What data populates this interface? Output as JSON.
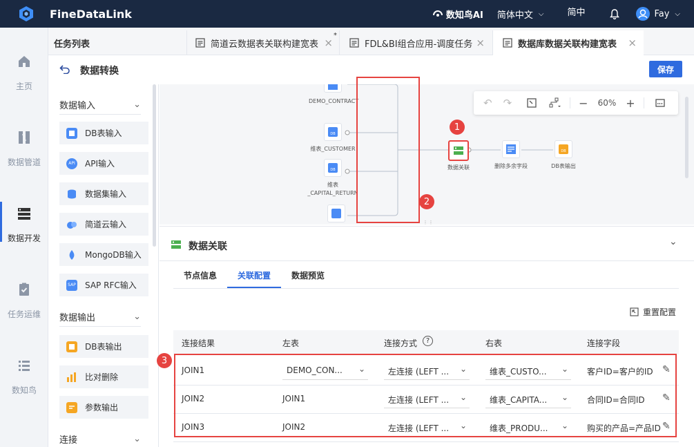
{
  "app": {
    "name": "FineDataLink",
    "ai_label": "数知鸟AI",
    "language": "简体中文",
    "lang_short": "简中",
    "user": "Fay"
  },
  "nav": [
    {
      "label": "主页",
      "icon": "home-icon"
    },
    {
      "label": "数据管道",
      "icon": "pipeline-icon"
    },
    {
      "label": "数据开发",
      "icon": "dev-icon"
    },
    {
      "label": "任务运维",
      "icon": "ops-icon"
    },
    {
      "label": "数知鸟",
      "icon": "bird-icon"
    }
  ],
  "tabs": {
    "task_list": "任务列表",
    "items": [
      {
        "label": "简道云数据表关联构建宽表",
        "mark": "*"
      },
      {
        "label": "FDL&BI组合应用-调度任务"
      },
      {
        "label": "数据库数据关联构建宽表"
      }
    ]
  },
  "page": {
    "title": "数据转换",
    "save": "保存"
  },
  "palette": {
    "input_title": "数据输入",
    "inputs": [
      "DB表输入",
      "API输入",
      "数据集输入",
      "简道云输入",
      "MongoDB输入",
      "SAP RFC输入"
    ],
    "output_title": "数据输出",
    "outputs": [
      "DB表输出",
      "比对删除",
      "参数输出"
    ],
    "join_title": "连接"
  },
  "canvas": {
    "nodes": {
      "contract": "DEMO_CONTRACT",
      "customer": "维表_CUSTOMER",
      "capital_1": "维表",
      "capital_2": "_CAPITAL_RETURN",
      "join": "数据关联",
      "remove": "删除多余字段",
      "output": "DB表输出"
    },
    "zoom": "60%"
  },
  "panel": {
    "title": "数据关联",
    "tabs": [
      "节点信息",
      "关联配置",
      "数据预览"
    ],
    "reset": "重置配置",
    "columns": [
      "连接结果",
      "左表",
      "连接方式",
      "右表",
      "连接字段"
    ],
    "rows": [
      {
        "result": "JOIN1",
        "left": "DEMO_CON...",
        "type": "左连接 (LEFT ...",
        "right": "维表_CUSTO...",
        "field": "客户ID=客户的ID"
      },
      {
        "result": "JOIN2",
        "left": "JOIN1",
        "type": "左连接 (LEFT ...",
        "right": "维表_CAPITA...",
        "field": "合同ID=合同ID"
      },
      {
        "result": "JOIN3",
        "left": "JOIN2",
        "type": "左连接 (LEFT ...",
        "right": "维表_PRODU...",
        "field": "购买的产品=产品ID"
      }
    ]
  },
  "badges": [
    "1",
    "2",
    "3"
  ]
}
